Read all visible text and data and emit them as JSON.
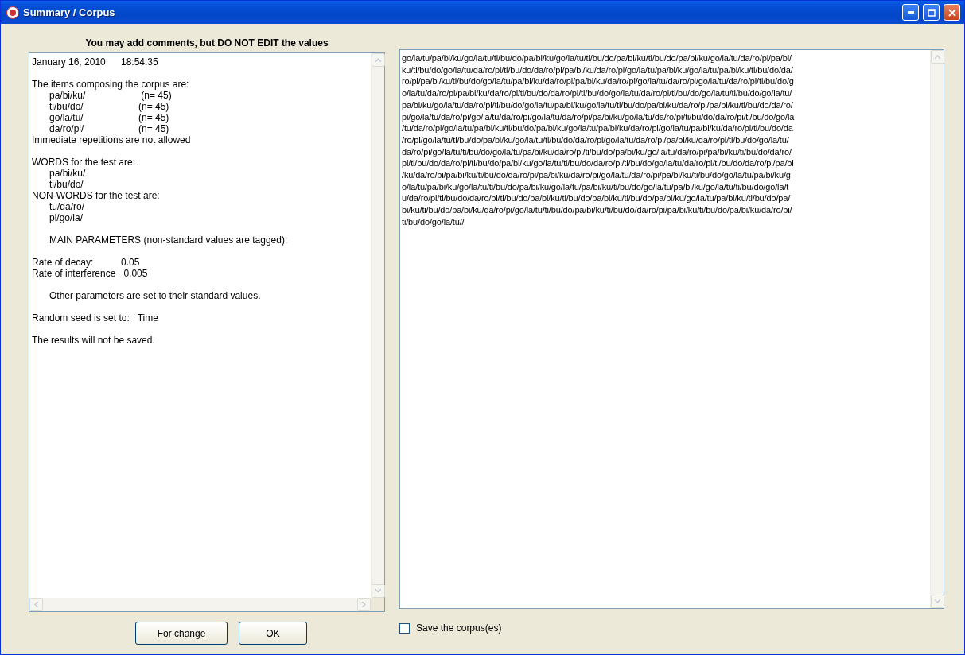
{
  "window": {
    "title": "Summary / Corpus"
  },
  "summary": {
    "heading": "You may add comments, but DO NOT EDIT the values",
    "lines": [
      {
        "kind": "pair",
        "cells": [
          "January 16, 2010",
          "18:54:35"
        ],
        "break_before": false,
        "indented": false
      },
      {
        "kind": "text",
        "text": "The items composing the corpus are:",
        "break_before": true,
        "indented": false
      },
      {
        "kind": "pair",
        "cells": [
          "pa/bi/ku/",
          " (n= 45)"
        ],
        "break_before": false,
        "indented": true
      },
      {
        "kind": "pair",
        "cells": [
          "ti/bu/do/",
          "(n= 45)"
        ],
        "break_before": false,
        "indented": true
      },
      {
        "kind": "pair",
        "cells": [
          "go/la/tu/",
          "(n= 45)"
        ],
        "break_before": false,
        "indented": true
      },
      {
        "kind": "pair",
        "cells": [
          "da/ro/pi/",
          "(n= 45)"
        ],
        "break_before": false,
        "indented": true
      },
      {
        "kind": "text",
        "text": "Immediate repetitions are not allowed",
        "break_before": false,
        "indented": false
      },
      {
        "kind": "text",
        "text": "WORDS for the test are:",
        "break_before": true,
        "indented": false
      },
      {
        "kind": "text",
        "text": "pa/bi/ku/",
        "break_before": false,
        "indented": true
      },
      {
        "kind": "text",
        "text": "ti/bu/do/",
        "break_before": false,
        "indented": true
      },
      {
        "kind": "text",
        "text": "NON-WORDS for the test are:",
        "break_before": false,
        "indented": false
      },
      {
        "kind": "text",
        "text": "tu/da/ro/",
        "break_before": false,
        "indented": true
      },
      {
        "kind": "text",
        "text": "pi/go/la/",
        "break_before": false,
        "indented": true
      },
      {
        "kind": "text",
        "text": "MAIN PARAMETERS (non-standard values are tagged):",
        "break_before": true,
        "indented": true
      },
      {
        "kind": "pair",
        "cells": [
          "Rate of decay:",
          "0.05"
        ],
        "break_before": true,
        "indented": false
      },
      {
        "kind": "pair",
        "cells": [
          "Rate of interference",
          "0.005"
        ],
        "break_before": false,
        "indented": false
      },
      {
        "kind": "text",
        "text": "Other parameters are set to their standard values.",
        "break_before": true,
        "indented": true
      },
      {
        "kind": "pair",
        "cells": [
          "Random seed is set to:",
          "Time"
        ],
        "break_before": true,
        "indented": false
      },
      {
        "kind": "text",
        "text": "The results will not be saved.",
        "break_before": true,
        "indented": false
      }
    ]
  },
  "buttons": [
    {
      "label": "For change"
    },
    {
      "label": "OK"
    }
  ],
  "corpus": {
    "lines": [
      "go/la/tu/pa/bi/ku/go/la/tu/ti/bu/do/pa/bi/ku/go/la/tu/ti/bu/do/pa/bi/ku/ti/bu/do/pa/bi/ku/go/la/tu/da/ro/pi/pa/bi/",
      "ku/ti/bu/do/go/la/tu/da/ro/pi/ti/bu/do/da/ro/pi/pa/bi/ku/da/ro/pi/go/la/tu/pa/bi/ku/go/la/tu/pa/bi/ku/ti/bu/do/da/",
      "ro/pi/pa/bi/ku/ti/bu/do/go/la/tu/pa/bi/ku/da/ro/pi/pa/bi/ku/da/ro/pi/go/la/tu/da/ro/pi/go/la/tu/da/ro/pi/ti/bu/do/g",
      "o/la/tu/da/ro/pi/pa/bi/ku/da/ro/pi/ti/bu/do/da/ro/pi/ti/bu/do/go/la/tu/da/ro/pi/ti/bu/do/go/la/tu/ti/bu/do/go/la/tu/",
      "pa/bi/ku/go/la/tu/da/ro/pi/ti/bu/do/go/la/tu/pa/bi/ku/go/la/tu/ti/bu/do/pa/bi/ku/da/ro/pi/pa/bi/ku/ti/bu/do/da/ro/",
      "pi/go/la/tu/da/ro/pi/go/la/tu/da/ro/pi/go/la/tu/da/ro/pi/pa/bi/ku/go/la/tu/da/ro/pi/ti/bu/do/da/ro/pi/ti/bu/do/go/la",
      "/tu/da/ro/pi/go/la/tu/pa/bi/ku/ti/bu/do/pa/bi/ku/go/la/tu/pa/bi/ku/da/ro/pi/go/la/tu/pa/bi/ku/da/ro/pi/ti/bu/do/da",
      "/ro/pi/go/la/tu/ti/bu/do/pa/bi/ku/go/la/tu/ti/bu/do/da/ro/pi/go/la/tu/da/ro/pi/pa/bi/ku/da/ro/pi/ti/bu/do/go/la/tu/",
      "da/ro/pi/go/la/tu/ti/bu/do/go/la/tu/pa/bi/ku/da/ro/pi/ti/bu/do/pa/bi/ku/go/la/tu/da/ro/pi/pa/bi/ku/ti/bu/do/da/ro/",
      "pi/ti/bu/do/da/ro/pi/ti/bu/do/pa/bi/ku/go/la/tu/ti/bu/do/da/ro/pi/ti/bu/do/go/la/tu/da/ro/pi/ti/bu/do/da/ro/pi/pa/bi",
      "/ku/da/ro/pi/pa/bi/ku/ti/bu/do/da/ro/pi/pa/bi/ku/da/ro/pi/go/la/tu/da/ro/pi/pa/bi/ku/ti/bu/do/go/la/tu/pa/bi/ku/g",
      "o/la/tu/pa/bi/ku/go/la/tu/ti/bu/do/pa/bi/ku/go/la/tu/pa/bi/ku/ti/bu/do/go/la/tu/pa/bi/ku/go/la/tu/ti/bu/do/go/la/t",
      "u/da/ro/pi/ti/bu/do/da/ro/pi/ti/bu/do/pa/bi/ku/ti/bu/do/pa/bi/ku/ti/bu/do/pa/bi/ku/go/la/tu/pa/bi/ku/ti/bu/do/pa/",
      "bi/ku/ti/bu/do/pa/bi/ku/da/ro/pi/go/la/tu/ti/bu/do/pa/bi/ku/ti/bu/do/da/ro/pi/pa/bi/ku/ti/bu/do/pa/bi/ku/da/ro/pi/",
      "ti/bu/do/go/la/tu//"
    ]
  },
  "save_option": {
    "label": "Save the corpus(es)",
    "checked": false
  }
}
